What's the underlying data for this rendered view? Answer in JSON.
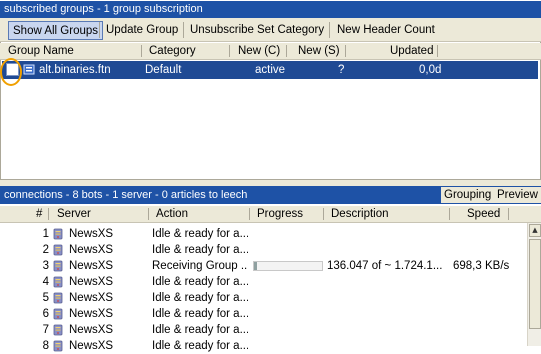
{
  "groups_pane": {
    "title": "subscribed groups - 1 group subscription",
    "toolbar": {
      "show_all": "Show All Groups",
      "update": "Update Group",
      "unsubscribe": "Unsubscribe",
      "set_category": "Set Category",
      "new_header_count": "New Header Count"
    },
    "columns": {
      "group_name": "Group Name",
      "category": "Category",
      "new_c": "New (C)",
      "new_s": "New (S)",
      "updated": "Updated"
    },
    "rows": [
      {
        "name": "alt.binaries.ftn",
        "category": "Default",
        "new_c": "active",
        "new_s": "?",
        "updated": "0,0d",
        "checked": false
      }
    ]
  },
  "connections_pane": {
    "title": "connections  -  8 bots  -  1 server  -  0 articles to leech",
    "buttons": {
      "grouping": "Grouping",
      "preview": "Preview"
    },
    "columns": {
      "num": "#",
      "server": "Server",
      "action": "Action",
      "progress": "Progress",
      "description": "Description",
      "speed": "Speed"
    },
    "rows": [
      {
        "num": "1",
        "server": "NewsXS",
        "action": "Idle & ready for a...",
        "progress": null,
        "description": "",
        "speed": ""
      },
      {
        "num": "2",
        "server": "NewsXS",
        "action": "Idle & ready for a...",
        "progress": null,
        "description": "",
        "speed": ""
      },
      {
        "num": "3",
        "server": "NewsXS",
        "action": "Receiving Group ...",
        "progress": 0.05,
        "description": "136.047 of ~ 1.724.1...",
        "speed": "698,3 KB/s"
      },
      {
        "num": "4",
        "server": "NewsXS",
        "action": "Idle & ready for a...",
        "progress": null,
        "description": "",
        "speed": ""
      },
      {
        "num": "5",
        "server": "NewsXS",
        "action": "Idle & ready for a...",
        "progress": null,
        "description": "",
        "speed": ""
      },
      {
        "num": "6",
        "server": "NewsXS",
        "action": "Idle & ready for a...",
        "progress": null,
        "description": "",
        "speed": ""
      },
      {
        "num": "7",
        "server": "NewsXS",
        "action": "Idle & ready for a...",
        "progress": null,
        "description": "",
        "speed": ""
      },
      {
        "num": "8",
        "server": "NewsXS",
        "action": "Idle & ready for a...",
        "progress": null,
        "description": "",
        "speed": ""
      }
    ]
  },
  "colors": {
    "titlebar": "#1e52a6",
    "selection": "#1f4a94",
    "highlight": "#f0a000"
  }
}
